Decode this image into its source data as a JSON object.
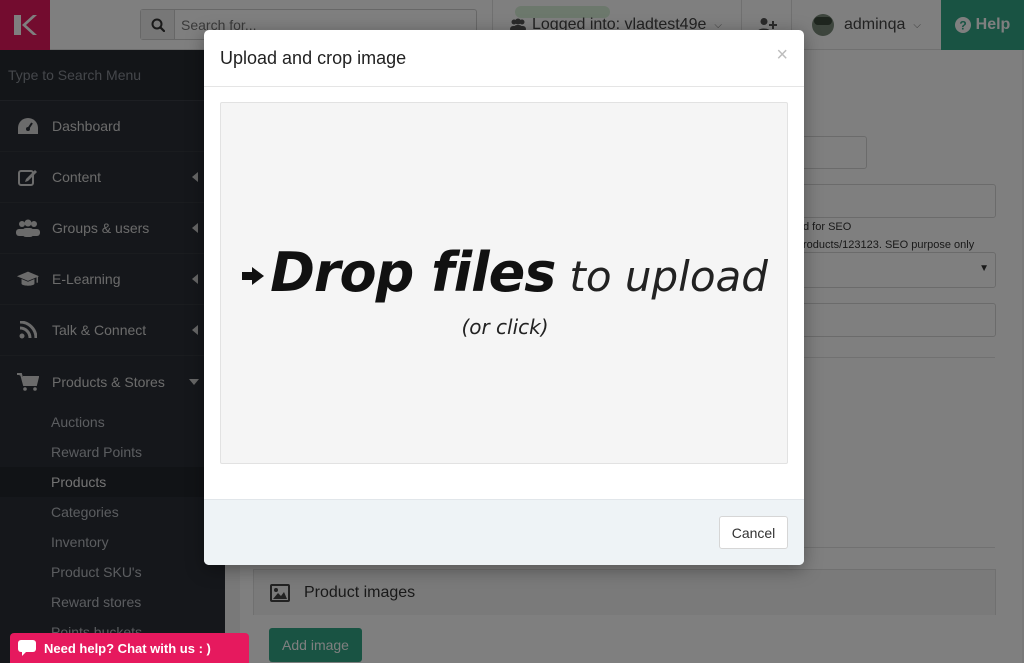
{
  "topbar": {
    "search_placeholder": "Search for...",
    "logged_label": "Logged into: vladtest49e",
    "user_name": "adminqa",
    "help_label": "Help"
  },
  "sidebar": {
    "search_placeholder": "Type to Search Menu",
    "items": [
      {
        "label": "Dashboard",
        "icon": "dashboard-icon"
      },
      {
        "label": "Content",
        "icon": "edit-icon"
      },
      {
        "label": "Groups & users",
        "icon": "users-icon"
      },
      {
        "label": "E-Learning",
        "icon": "graduation-cap-icon"
      },
      {
        "label": "Talk & Connect",
        "icon": "rss-icon"
      },
      {
        "label": "Products & Stores",
        "icon": "cart-icon"
      }
    ],
    "sub_items": [
      "Auctions",
      "Reward Points",
      "Products",
      "Categories",
      "Inventory",
      "Product SKU's",
      "Reward stores",
      "Points buckets"
    ],
    "active_sub_item": "Products"
  },
  "main": {
    "seo_hint_1": "d for SEO",
    "seo_hint_2": "roducts/123123. SEO purpose only",
    "images_section_title": "Product images",
    "add_image_label": "Add image"
  },
  "modal": {
    "title": "Upload and crop image",
    "close_glyph": "×",
    "drop_strong": "Drop files",
    "drop_light": "to upload",
    "drop_sub": "(or click)",
    "cancel_label": "Cancel"
  },
  "chat": {
    "label": "Need help? Chat with us : )"
  },
  "colors": {
    "brand": "#e6195e",
    "accent_green": "#32a787",
    "sidebar_bg": "#2b2f36"
  }
}
